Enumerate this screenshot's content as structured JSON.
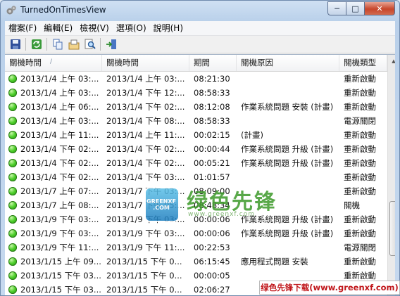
{
  "window": {
    "title": "TurnedOnTimesView",
    "min_label": "─",
    "max_label": "□",
    "close_label": "✕"
  },
  "menu": [
    "檔案(F)",
    "編輯(E)",
    "檢視(V)",
    "選項(O)",
    "說明(H)"
  ],
  "toolbar": {
    "buttons": [
      "save-icon",
      "refresh-icon",
      "copy-icon",
      "properties-icon",
      "find-icon",
      "exit-icon"
    ]
  },
  "columns": {
    "c1": "關機時間",
    "c2": "關機時間",
    "c3": "期間",
    "c4": "關機原因",
    "c5": "關機類型",
    "sort_glyph": "/"
  },
  "rows": [
    [
      "2013/1/4 上午 03:...",
      "2013/1/4 上午 03:...",
      "08:21:30",
      "",
      "重新啟動"
    ],
    [
      "2013/1/4 上午 03:...",
      "2013/1/4 下午 12:...",
      "08:58:33",
      "",
      "重新啟動"
    ],
    [
      "2013/1/4 上午 06:...",
      "2013/1/4 下午 02:...",
      "08:12:08",
      "作業系統問題 安裝 (計畫)",
      "重新啟動"
    ],
    [
      "2013/1/4 上午 03:...",
      "2013/1/4 下午 08:...",
      "08:58:33",
      "",
      "電源關閉"
    ],
    [
      "2013/1/4 上午 11:...",
      "2013/1/4 上午 11:...",
      "00:02:15",
      "(計畫)",
      "重新啟動"
    ],
    [
      "2013/1/4 下午 02:...",
      "2013/1/4 下午 02:...",
      "00:00:44",
      "作業系統問題 升級 (計畫)",
      "重新啟動"
    ],
    [
      "2013/1/4 下午 02:...",
      "2013/1/4 下午 02:...",
      "00:05:21",
      "作業系統問題 升級 (計畫)",
      "重新啟動"
    ],
    [
      "2013/1/4 下午 02:...",
      "2013/1/4 下午 03:...",
      "01:01:57",
      "",
      "重新啟動"
    ],
    [
      "2013/1/7 上午 07:...",
      "2013/1/7 下午 03:...",
      "08:09:00",
      "",
      "重新啟動"
    ],
    [
      "2013/1/7 上午 08:...",
      "2013/1/7 下午 05:...",
      "08:48:34",
      "",
      "關機"
    ],
    [
      "2013/1/9 下午 03:...",
      "2013/1/9 下午 03:...",
      "00:00:06",
      "作業系統問題 升級 (計畫)",
      "重新啟動"
    ],
    [
      "2013/1/9 下午 03:...",
      "2013/1/9 下午 03:...",
      "00:00:06",
      "作業系統問題 升級 (計畫)",
      "重新啟動"
    ],
    [
      "2013/1/9 下午 11:...",
      "2013/1/9 下午 11:...",
      "00:22:53",
      "",
      "電源關閉"
    ],
    [
      "2013/1/15 上午 09...",
      "2013/1/15 下午 0...",
      "06:15:45",
      "應用程式問題 安裝",
      "重新啟動"
    ],
    [
      "2013/1/15 下午 03...",
      "2013/1/15 下午 0...",
      "00:00:05",
      "",
      "重新啟動"
    ],
    [
      "2013/1/15 下午 03...",
      "2013/1/15 下午 0...",
      "02:06:27",
      "",
      "重新啟動"
    ]
  ],
  "watermark": {
    "brand": "绿色先锋",
    "badge": "GREENXF .COM",
    "url": "www.greenxf.com"
  },
  "banner": "绿色先锋下载(www.greenxf.com)"
}
